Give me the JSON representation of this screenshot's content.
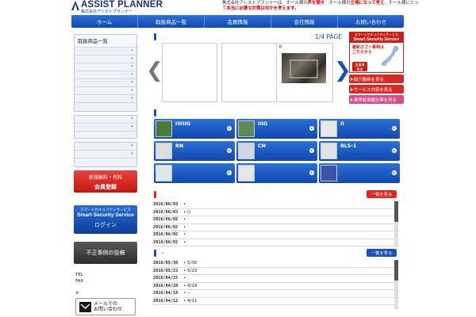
{
  "header": {
    "logo_main": "ASSIST PLANNER",
    "logo_sub": "株式会社アシストプランナー",
    "tagline_a": "株式会社アシストプランナーは、ホール様の",
    "tagline_b": "声を聞き",
    "tagline_c": "、ホール様の",
    "tagline_d": "立場になって考え",
    "tagline_e": "、ホール様にとって",
    "tagline_f": "本当に必要な対策は何かを考えます。"
  },
  "nav": [
    "ホーム",
    "取扱商品一覧",
    "会員情報",
    "会社情報",
    "お問い合わせ"
  ],
  "sidebar": {
    "products_title": "取扱商品一覧",
    "register_t1": "新規無料・有料",
    "register_t2": "会員登録",
    "login_t1": "スマートセキュリティサービス",
    "login_t2": "Smart Security Service",
    "login_t3": "ログイン",
    "fraud_post": "不正事例の投稿",
    "tel": "TEL",
    "fax": "FAX",
    "note": "※",
    "mail_t1": "メールでの",
    "mail_t2": "お問い合わせ"
  },
  "slider": {
    "page_label": "1/4 PAGE",
    "slide3_icon": "▣"
  },
  "ad": {
    "top1": "スマートセキュリティサービス",
    "top2": "Smart Security Service",
    "body1": "最新のゴト事例は",
    "body2": "こちらから",
    "badge1": "会員様",
    "badge2": "専用",
    "links": [
      "紹介動画を見る",
      "サービス内容を見る",
      "業界紙掲載記事を見る"
    ]
  },
  "products": [
    {
      "name": "IIIIIIG"
    },
    {
      "name": "IIIG"
    },
    {
      "name": "II"
    },
    {
      "name": "RN"
    },
    {
      "name": "CN"
    },
    {
      "name": "BLS-1"
    },
    {
      "name": ""
    },
    {
      "name": ""
    },
    {
      "name": ""
    }
  ],
  "news1": {
    "more": "一覧を見る",
    "rows": [
      {
        "date": "2016/06/03",
        "text": ""
      },
      {
        "date": "2016/06/03",
        "text": "()"
      },
      {
        "date": "2016/06/02",
        "text": ""
      },
      {
        "date": "2016/06/02",
        "text": ""
      },
      {
        "date": "2016/06/02",
        "text": ""
      },
      {
        "date": "2016/06/02",
        "text": ""
      }
    ]
  },
  "news2": {
    "dot": "・",
    "more": "一覧を見る",
    "rows": [
      {
        "date": "2016/05/30",
        "text": "5/30"
      },
      {
        "date": "2016/05/23",
        "text": "5/23"
      },
      {
        "date": "2016/04/25",
        "text": ""
      },
      {
        "date": "2016/04/20",
        "text": "4/18"
      },
      {
        "date": "2016/04/18",
        "text": "--"
      },
      {
        "date": "2016/04/12",
        "text": "4/11"
      }
    ]
  },
  "colors": {
    "brand": "#14337a",
    "nav": "#0f4bb2",
    "accent_red": "#c62119"
  }
}
